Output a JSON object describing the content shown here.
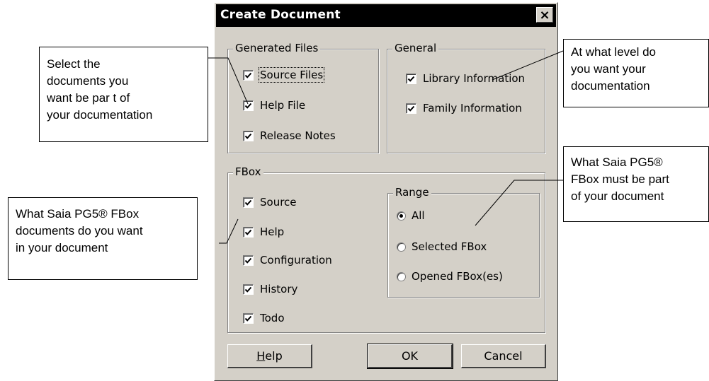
{
  "dialog": {
    "title": "Create Document",
    "close_glyph": "×",
    "generated_files": {
      "title": "Generated Files",
      "items": [
        {
          "label": "Source Files",
          "checked": true
        },
        {
          "label": "Help File",
          "checked": true
        },
        {
          "label": "Release Notes",
          "checked": true
        }
      ]
    },
    "general": {
      "title": "General",
      "items": [
        {
          "label": "Library Information",
          "checked": true
        },
        {
          "label": "Family Information",
          "checked": true
        }
      ]
    },
    "fbox": {
      "title": "FBox",
      "items": [
        {
          "label": "Source",
          "checked": true
        },
        {
          "label": "Help",
          "checked": true
        },
        {
          "label": "Configuration",
          "checked": true
        },
        {
          "label": "History",
          "checked": true
        },
        {
          "label": "Todo",
          "checked": true
        }
      ],
      "range": {
        "title": "Range",
        "options": [
          {
            "label": "All",
            "selected": true
          },
          {
            "label": "Selected FBox",
            "selected": false
          },
          {
            "label": "Opened FBox(es)",
            "selected": false
          }
        ]
      }
    },
    "buttons": {
      "help": "Help",
      "ok": "OK",
      "cancel": "Cancel"
    }
  },
  "callouts": {
    "generated_files": [
      "Select the",
      "documents you",
      "want be par t of",
      "your documentation"
    ],
    "general": [
      "At what level do",
      "you want your",
      "documentation"
    ],
    "fbox": [
      "What Saia PG5® FBox",
      "documents do you want",
      "in your document"
    ],
    "range": [
      "What Saia PG5®",
      "FBox must be part",
      "of your document"
    ]
  },
  "icons": {
    "checkmark": "checkmark-icon",
    "radio": "radio-dot-icon",
    "close": "close-icon"
  }
}
